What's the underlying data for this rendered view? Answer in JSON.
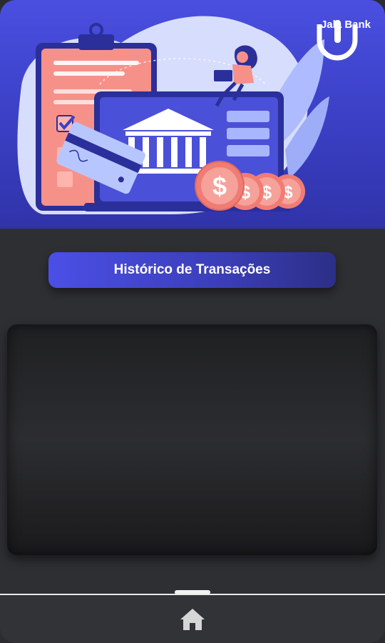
{
  "brand": {
    "name": "Jala Bank"
  },
  "page": {
    "title": "Histórico de Transações"
  },
  "transactions": [],
  "nav": {
    "home_icon": "home-icon"
  },
  "colors": {
    "accent": "#4a4fe0",
    "accent_dark": "#3033a8",
    "background": "#2e2f33",
    "coin": "#f28a80"
  }
}
